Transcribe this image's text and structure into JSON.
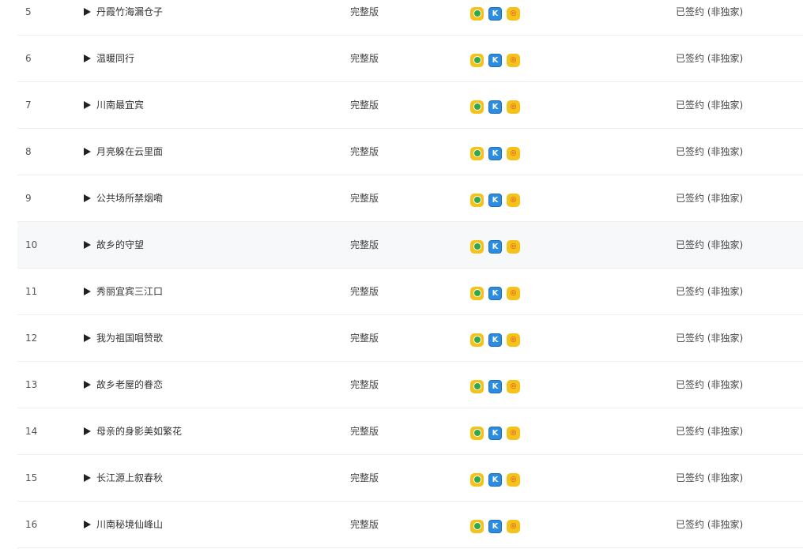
{
  "platform_icons": [
    {
      "name": "qq-music-icon",
      "glyph": "",
      "color": "#f5c21b"
    },
    {
      "name": "kugou-icon",
      "glyph": "K",
      "color": "#2c8ce0"
    },
    {
      "name": "kuwo-icon",
      "glyph": "◎",
      "color": "#f5c21b"
    }
  ],
  "rows": [
    {
      "index": "5",
      "title": "丹霞竹海漏仓子",
      "version": "完整版",
      "status": "已签约 (非独家)"
    },
    {
      "index": "6",
      "title": "温暖同行",
      "version": "完整版",
      "status": "已签约 (非独家)"
    },
    {
      "index": "7",
      "title": "川南最宜宾",
      "version": "完整版",
      "status": "已签约 (非独家)"
    },
    {
      "index": "8",
      "title": "月亮躲在云里面",
      "version": "完整版",
      "status": "已签约 (非独家)"
    },
    {
      "index": "9",
      "title": "公共场所禁烟嘞",
      "version": "完整版",
      "status": "已签约 (非独家)"
    },
    {
      "index": "10",
      "title": "故乡的守望",
      "version": "完整版",
      "status": "已签约 (非独家)",
      "hover": true
    },
    {
      "index": "11",
      "title": "秀丽宜宾三江口",
      "version": "完整版",
      "status": "已签约 (非独家)"
    },
    {
      "index": "12",
      "title": "我为祖国唱赞歌",
      "version": "完整版",
      "status": "已签约 (非独家)"
    },
    {
      "index": "13",
      "title": "故乡老屋的眷恋",
      "version": "完整版",
      "status": "已签约 (非独家)"
    },
    {
      "index": "14",
      "title": "母亲的身影美如繁花",
      "version": "完整版",
      "status": "已签约 (非独家)"
    },
    {
      "index": "15",
      "title": "长江源上叙春秋",
      "version": "完整版",
      "status": "已签约 (非独家)"
    },
    {
      "index": "16",
      "title": "川南秘境仙峰山",
      "version": "完整版",
      "status": "已签约 (非独家)"
    }
  ]
}
